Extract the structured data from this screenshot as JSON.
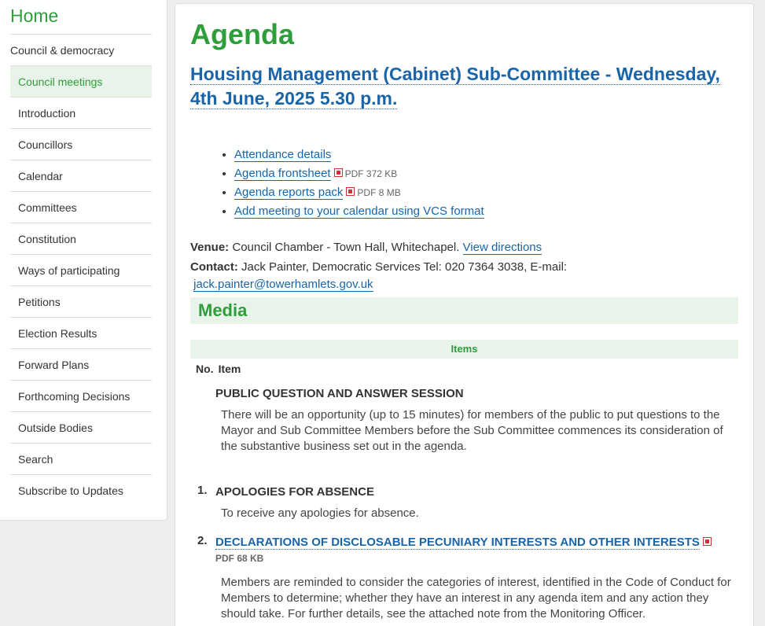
{
  "sidebar": {
    "home": "Home",
    "section": "Council & democracy",
    "items": [
      {
        "label": "Council meetings"
      },
      {
        "label": "Introduction"
      },
      {
        "label": "Councillors"
      },
      {
        "label": "Calendar"
      },
      {
        "label": "Committees"
      },
      {
        "label": "Constitution"
      },
      {
        "label": "Ways of participating"
      },
      {
        "label": "Petitions"
      },
      {
        "label": "Election Results"
      },
      {
        "label": "Forward Plans"
      },
      {
        "label": "Forthcoming Decisions"
      },
      {
        "label": "Outside Bodies"
      },
      {
        "label": "Search"
      },
      {
        "label": "Subscribe to Updates"
      }
    ]
  },
  "main": {
    "heading": "Agenda",
    "meeting_title": "Housing Management (Cabinet) Sub-Committee - Wednesday, 4th June, 2025 5.30 p.m.",
    "links": [
      {
        "label": "Attendance details",
        "size": ""
      },
      {
        "label": "Agenda frontsheet",
        "size": "PDF 372 KB"
      },
      {
        "label": "Agenda reports pack",
        "size": "PDF 8 MB"
      },
      {
        "label": "Add meeting to your calendar using VCS format",
        "size": ""
      }
    ],
    "venue_label": "Venue:",
    "venue_text": "Council Chamber - Town Hall, Whitechapel.",
    "venue_link": "View directions",
    "contact_label": "Contact:",
    "contact_text": "Jack Painter, Democratic Services  Tel: 020 7364 3038, E-mail:",
    "contact_email": "jack.painter@towerhamlets.gov.uk",
    "media_heading": "Media",
    "items_heading": "Items",
    "col_no": "No.",
    "col_item": "Item",
    "items": [
      {
        "num": "",
        "title": "PUBLIC QUESTION AND ANSWER SESSION",
        "desc": "There will be an opportunity (up to 15 minutes) for members of the public to put questions to the Mayor and Sub Committee Members before the Sub Committee commences its consideration of the substantive business set out in the agenda."
      },
      {
        "num": "1.",
        "title": "APOLOGIES FOR ABSENCE",
        "desc": "To receive any apologies for absence."
      },
      {
        "num": "2.",
        "title": "DECLARATIONS OF DISCLOSABLE PECUNIARY INTERESTS AND OTHER INTERESTS",
        "size": "PDF 68 KB",
        "desc": "Members are reminded to consider the categories of interest, identified in the Code of Conduct for Members to determine; whether they have an interest in any agenda item and any action they should take. For further details, see the attached note from the Monitoring Officer."
      }
    ]
  },
  "colors": {
    "accent_green": "#2e9e3a",
    "link_blue": "#1a64a8",
    "highlight_bg": "#e8f4ea"
  }
}
